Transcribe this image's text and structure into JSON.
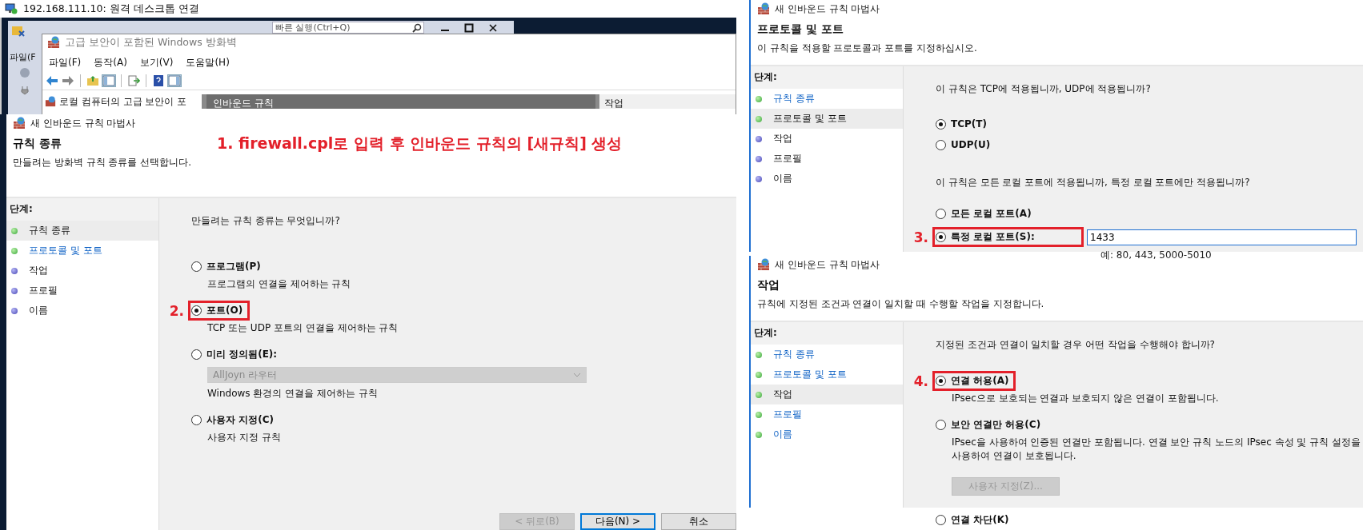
{
  "remote_desktop": {
    "title": "192.168.111.10: 원격 데스크톱 연결"
  },
  "ssms_window": {
    "menu_label": "파일(F",
    "quick_launch": {
      "placeholder": "빠른 실행(Ctrl+Q)"
    }
  },
  "firewall_window": {
    "title": "고급 보안이 포함된 Windows 방화벽",
    "menu": [
      "파일(F)",
      "동작(A)",
      "보기(V)",
      "도움말(H)"
    ],
    "tree_item": "로컬 컴퓨터의 고급 보안이 포",
    "center_header": "인바운드 규칙",
    "actions_header": "작업"
  },
  "wizards": [
    {
      "title": "새 인바운드 규칙 마법사",
      "heading": "규칙 종류",
      "subtitle": "만들려는 방화벽 규칙 종류를 선택합니다.",
      "note": "1. firewall.cpl로 입력 후 인바운드 규칙의 [새규칙] 생성",
      "steps_header": "단계:",
      "steps": [
        {
          "label": "규칙 종류",
          "selected": true,
          "done": true,
          "link": false
        },
        {
          "label": "프로토콜 및 포트",
          "selected": false,
          "done": true,
          "link": true
        },
        {
          "label": "작업",
          "selected": false,
          "done": false,
          "link": false
        },
        {
          "label": "프로필",
          "selected": false,
          "done": false,
          "link": false
        },
        {
          "label": "이름",
          "selected": false,
          "done": false,
          "link": false
        }
      ],
      "content": [
        {
          "kind": "question",
          "text": "만들려는 규칙 종류는 무엇입니까?"
        },
        {
          "kind": "radio",
          "label": "프로그램(P)",
          "selected": false,
          "highlight": false
        },
        {
          "kind": "description",
          "text": "프로그램의 연결을 제어하는 규칙"
        },
        {
          "kind": "radio",
          "label": "포트(O)",
          "selected": true,
          "highlight": true,
          "callout": "2."
        },
        {
          "kind": "description",
          "text": "TCP 또는 UDP 포트의 연결을 제어하는 규칙"
        },
        {
          "kind": "radio",
          "label": "미리 정의됨(E):",
          "selected": false,
          "highlight": false
        },
        {
          "kind": "dropdown",
          "value": "AllJoyn 라우터",
          "disabled": true
        },
        {
          "kind": "description",
          "text": "Windows 환경의 연결을 제어하는 규칙"
        },
        {
          "kind": "radio",
          "label": "사용자 지정(C)",
          "selected": false,
          "highlight": false
        },
        {
          "kind": "description",
          "text": "사용자 지정 규칙"
        }
      ],
      "buttons": [
        {
          "label": "< 뒤로(B)",
          "disabled": true,
          "default": false
        },
        {
          "label": "다음(N) >",
          "disabled": false,
          "default": true
        },
        {
          "label": "취소",
          "disabled": false,
          "default": false
        }
      ]
    },
    {
      "title": "새 인바운드 규칙 마법사",
      "heading": "프로토콜 및 포트",
      "subtitle": "이 규칙을 적용할 프로토콜과 포트를 지정하십시오.",
      "steps_header": "단계:",
      "steps": [
        {
          "label": "규칙 종류",
          "selected": false,
          "done": true,
          "link": true
        },
        {
          "label": "프로토콜 및 포트",
          "selected": true,
          "done": true,
          "link": false
        },
        {
          "label": "작업",
          "selected": false,
          "done": false,
          "link": false
        },
        {
          "label": "프로필",
          "selected": false,
          "done": false,
          "link": false
        },
        {
          "label": "이름",
          "selected": false,
          "done": false,
          "link": false
        }
      ],
      "content": [
        {
          "kind": "question",
          "text": "이 규칙은 TCP에 적용됩니까, UDP에 적용됩니까?"
        },
        {
          "kind": "radio",
          "label": "TCP(T)",
          "selected": true,
          "highlight": false
        },
        {
          "kind": "radio",
          "label": "UDP(U)",
          "selected": false,
          "highlight": false
        },
        {
          "kind": "question",
          "text": "이 규칙은 모든 로컬 포트에 적용됩니까, 특정 로컬 포트에만 적용됩니까?"
        },
        {
          "kind": "radio",
          "label": "모든 로컬 포트(A)",
          "selected": false,
          "highlight": false
        },
        {
          "kind": "radio",
          "label": "특정 로컬 포트(S):",
          "selected": true,
          "highlight": true,
          "callout": "3.",
          "field": {
            "value": "1433"
          }
        },
        {
          "kind": "hint",
          "text": "예: 80, 443, 5000-5010"
        }
      ]
    },
    {
      "title": "새 인바운드 규칙 마법사",
      "heading": "작업",
      "subtitle": "규칙에 지정된 조건과 연결이 일치할 때 수행할 작업을 지정합니다.",
      "steps_header": "단계:",
      "steps": [
        {
          "label": "규칙 종류",
          "selected": false,
          "done": true,
          "link": true
        },
        {
          "label": "프로토콜 및 포트",
          "selected": false,
          "done": true,
          "link": true
        },
        {
          "label": "작업",
          "selected": true,
          "done": true,
          "link": false
        },
        {
          "label": "프로필",
          "selected": false,
          "done": true,
          "link": true
        },
        {
          "label": "이름",
          "selected": false,
          "done": true,
          "link": true
        }
      ],
      "content": [
        {
          "kind": "question",
          "text": "지정된 조건과 연결이 일치할 경우 어떤 작업을 수행해야 합니까?"
        },
        {
          "kind": "radio",
          "label": "연결 허용(A)",
          "selected": true,
          "highlight": true,
          "callout": "4."
        },
        {
          "kind": "description",
          "text": "IPsec으로 보호되는 연결과 보호되지 않은 연결이 포함됩니다."
        },
        {
          "kind": "radio",
          "label": "보안 연결만 허용(C)",
          "selected": false,
          "highlight": false
        },
        {
          "kind": "description",
          "text": "IPsec을 사용하여 인증된 연결만 포함됩니다. 연결 보안 규칙 노드의 IPsec 속성 및 규칙 설정을 사용하여 연결이 보호됩니다."
        },
        {
          "kind": "button",
          "label": "사용자 지정(Z)...",
          "disabled": true
        },
        {
          "kind": "radio",
          "label": "연결 차단(K)",
          "selected": false,
          "highlight": false
        }
      ]
    }
  ]
}
